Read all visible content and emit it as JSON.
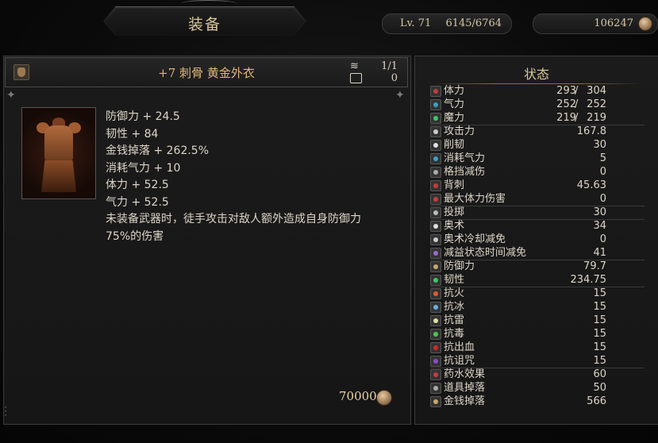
{
  "header": {
    "title": "装备",
    "level_label": "Lv.  71",
    "experience": "6145/6764",
    "currency": "106247"
  },
  "item": {
    "name": "+7  刺骨  黄金外衣",
    "stack": "1/1",
    "storage": "0",
    "stats": [
      "防御力 + 24.5",
      "韧性 + 84",
      "金钱掉落 + 262.5%",
      "消耗气力 + 10",
      "体力 + 52.5",
      "气力 + 52.5"
    ],
    "description": "未装备武器时，徒手攻击对敌人额外造成自身防御力75%的伤害",
    "price": "70000"
  },
  "status": {
    "title": "状态",
    "resources": [
      {
        "label": "体力",
        "current": "293",
        "max": "304",
        "icon": "health-icon",
        "color": "#c83c3c"
      },
      {
        "label": "气力",
        "current": "252",
        "max": "252",
        "icon": "stamina-icon",
        "color": "#3aa0c8"
      },
      {
        "label": "魔力",
        "current": "219",
        "max": "219",
        "icon": "mana-icon",
        "color": "#3ac86a"
      }
    ],
    "groups": [
      [
        {
          "label": "攻击力",
          "value": "167.8",
          "icon": "attack-icon",
          "color": "#cccccc"
        },
        {
          "label": "削韧",
          "value": "30",
          "icon": "poise-break-icon",
          "color": "#e0e0e0"
        },
        {
          "label": "消耗气力",
          "value": "5",
          "icon": "stamina-cost-icon",
          "color": "#3aa0c8"
        },
        {
          "label": "格挡减伤",
          "value": "0",
          "icon": "block-icon",
          "color": "#aaaaaa"
        },
        {
          "label": "背刺",
          "value": "45.63",
          "icon": "backstab-icon",
          "color": "#c83c3c"
        },
        {
          "label": "最大体力伤害",
          "value": "0",
          "icon": "max-hp-damage-icon",
          "color": "#c83c3c"
        }
      ],
      [
        {
          "label": "投掷",
          "value": "30",
          "icon": "throw-icon",
          "color": "#bbbbbb"
        }
      ],
      [
        {
          "label": "奥术",
          "value": "34",
          "icon": "arcane-icon",
          "color": "#e0e0e0"
        },
        {
          "label": "奥术冷却减免",
          "value": "0",
          "icon": "arcane-cooldown-icon",
          "color": "#cccccc"
        },
        {
          "label": "减益状态时间减免",
          "value": "41",
          "icon": "debuff-reduction-icon",
          "color": "#9a6ac8"
        }
      ],
      [
        {
          "label": "防御力",
          "value": "79.7",
          "icon": "defense-icon",
          "color": "#c8a86a"
        },
        {
          "label": "韧性",
          "value": "234.75",
          "icon": "poise-icon",
          "color": "#3ac86a"
        }
      ],
      [
        {
          "label": "抗火",
          "value": "15",
          "icon": "fire-resist-icon",
          "color": "#e05a2a"
        },
        {
          "label": "抗冰",
          "value": "15",
          "icon": "ice-resist-icon",
          "color": "#6ab0e0"
        },
        {
          "label": "抗雷",
          "value": "15",
          "icon": "lightning-resist-icon",
          "color": "#e0e0a0"
        },
        {
          "label": "抗毒",
          "value": "15",
          "icon": "poison-resist-icon",
          "color": "#4ac84a"
        },
        {
          "label": "抗出血",
          "value": "15",
          "icon": "bleed-resist-icon",
          "color": "#d02a2a"
        },
        {
          "label": "抗诅咒",
          "value": "15",
          "icon": "curse-resist-icon",
          "color": "#8a4ac8"
        }
      ],
      [
        {
          "label": "药水效果",
          "value": "60",
          "icon": "potion-icon",
          "color": "#c83c3c"
        },
        {
          "label": "道具掉落",
          "value": "50",
          "icon": "item-drop-icon",
          "color": "#aaaaaa"
        },
        {
          "label": "金钱掉落",
          "value": "566",
          "icon": "money-drop-icon",
          "color": "#c8a86a"
        }
      ]
    ]
  }
}
